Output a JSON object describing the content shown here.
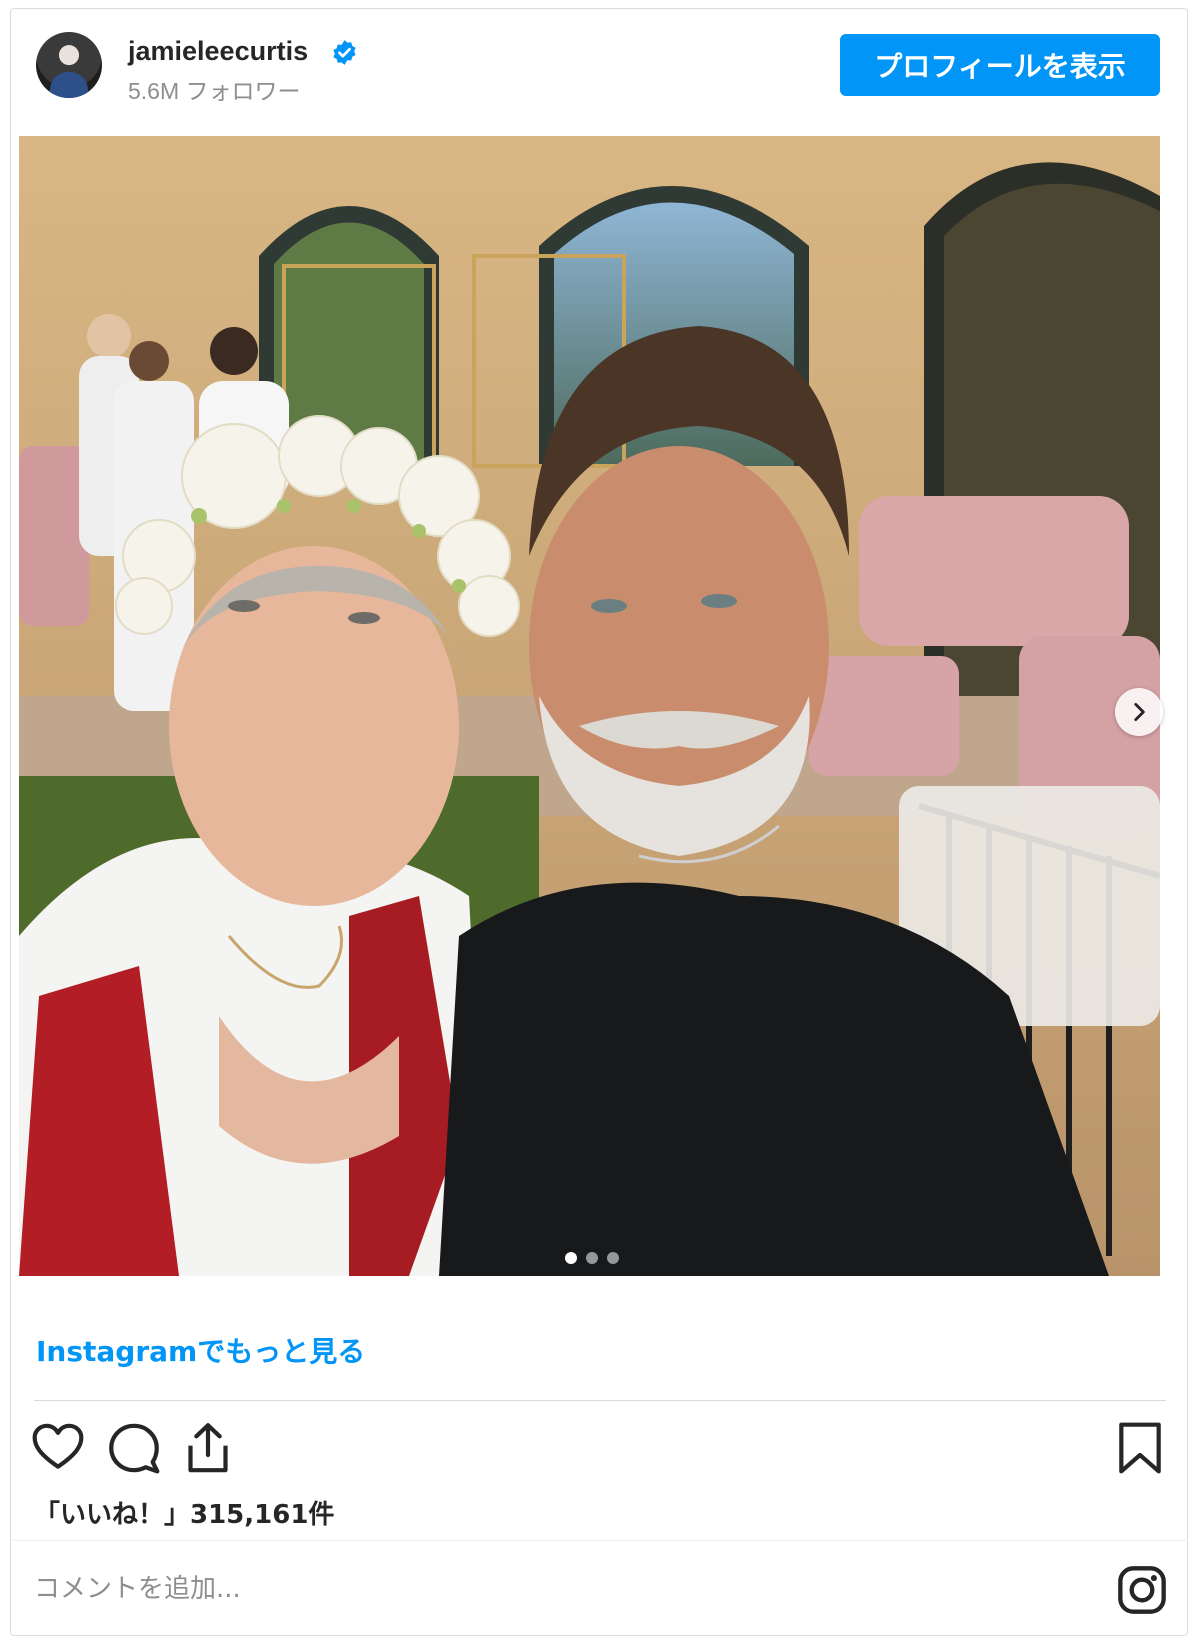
{
  "header": {
    "username": "jamieleecurtis",
    "verified": true,
    "followers_text": "5.6M フォロワー",
    "profile_button_label": "プロフィールを表示"
  },
  "post": {
    "image_count": 3,
    "active_image_index": 0
  },
  "links": {
    "more_on_instagram": "Instagramでもっと見る"
  },
  "actions": {
    "like_icon": "heart-icon",
    "comment_icon": "comment-icon",
    "share_icon": "share-icon",
    "save_icon": "bookmark-icon"
  },
  "likes": {
    "text": "「いいね！」315,161件"
  },
  "comment": {
    "placeholder": "コメントを追加..."
  },
  "colors": {
    "accent": "#0095f6",
    "text": "#262626",
    "muted": "#8e8e8e",
    "border": "#dbdbdb"
  }
}
